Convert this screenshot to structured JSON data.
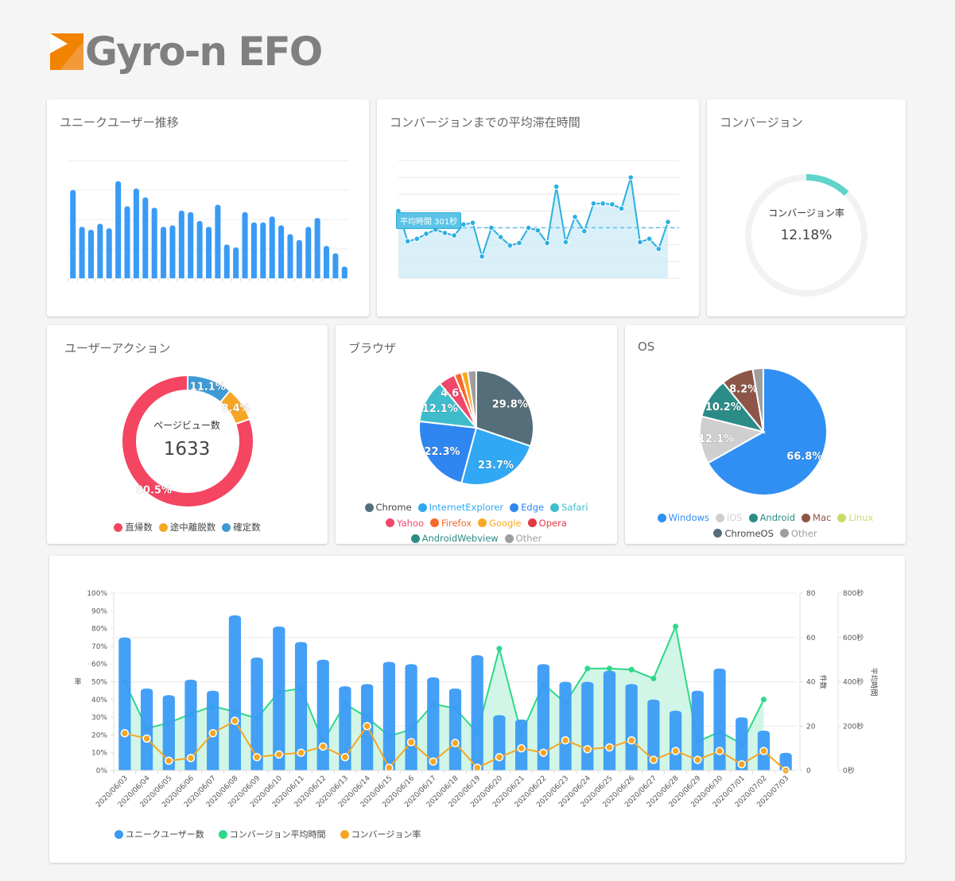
{
  "app": {
    "logo_text": "Gyro-n EFO",
    "brand_color": "#f08300"
  },
  "unique_users": {
    "title": "ユニークユーザー推移",
    "color": "#3a9bf5",
    "values": [
      60,
      35,
      33,
      37,
      34,
      66,
      49,
      61,
      55,
      48,
      35,
      36,
      46,
      45,
      39,
      35,
      50,
      23,
      21,
      45,
      38,
      38,
      42,
      36,
      30,
      26,
      35,
      41,
      22,
      17,
      8
    ]
  },
  "avg_time": {
    "title": "コンバージョンまでの平均滞在時間",
    "color": "#2bafe0",
    "avg_label": "平均時間 301秒",
    "avg_value": 301,
    "values": [
      400,
      220,
      235,
      265,
      290,
      270,
      255,
      320,
      330,
      130,
      300,
      245,
      195,
      210,
      300,
      285,
      210,
      545,
      215,
      365,
      280,
      445,
      445,
      440,
      415,
      600,
      215,
      235,
      175,
      335
    ],
    "ymax": 700
  },
  "conversion": {
    "title": "コンバージョン",
    "center_label": "コンバージョン率",
    "value_text": "12.18%",
    "rate": 0.1218,
    "color": "#5fd3cc",
    "track_color": "#f2f2f2"
  },
  "user_action": {
    "title": "ユーザーアクション",
    "center_label": "ページビュー数",
    "center_value": "1633",
    "slices": [
      {
        "name": "確定数",
        "value": 11.1,
        "label": "11.1%",
        "color": "#3e9bd6"
      },
      {
        "name": "途中離脱数",
        "value": 8.4,
        "label": "8.4%",
        "color": "#f5a623"
      },
      {
        "name": "直帰数",
        "value": 80.5,
        "label": "80.5%",
        "color": "#f44561"
      }
    ],
    "legend": [
      {
        "name": "直帰数",
        "color": "#f44561"
      },
      {
        "name": "途中離脱数",
        "color": "#f5a623"
      },
      {
        "name": "確定数",
        "color": "#3e9bd6"
      }
    ]
  },
  "browser": {
    "title": "ブラウザ",
    "slices": [
      {
        "name": "Chrome",
        "value": 29.8,
        "label": "29.8%",
        "color": "#546e7a"
      },
      {
        "name": "InternetExplorer",
        "value": 23.7,
        "label": "23.7%",
        "color": "#31a8f3"
      },
      {
        "name": "Edge",
        "value": 22.3,
        "label": "22.3%",
        "color": "#2f86f0"
      },
      {
        "name": "Safari",
        "value": 12.1,
        "label": "12.1%",
        "color": "#3fbccc"
      },
      {
        "name": "Yahoo",
        "value": 4.6,
        "label": "4.6%",
        "color": "#f0476a"
      },
      {
        "name": "Firefox",
        "value": 2.0,
        "label": "",
        "color": "#f56a2c"
      },
      {
        "name": "Google",
        "value": 1.8,
        "label": "",
        "color": "#f9a825"
      },
      {
        "name": "Opera",
        "value": 0.0,
        "label": "",
        "color": "#e53945"
      },
      {
        "name": "AndroidWebview",
        "value": 0.0,
        "label": "",
        "color": "#2a8c85"
      },
      {
        "name": "Other",
        "value": 2.4,
        "label": "",
        "color": "#9e9e9e"
      }
    ],
    "legend_rows": [
      [
        0,
        1,
        2,
        3
      ],
      [
        4,
        5,
        6,
        7
      ],
      [
        8,
        9
      ]
    ]
  },
  "os": {
    "title": "OS",
    "slices": [
      {
        "name": "Windows",
        "value": 66.8,
        "label": "66.8%",
        "color": "#2f8ff2"
      },
      {
        "name": "iOS",
        "value": 12.1,
        "label": "12.1%",
        "color": "#cfcfcf"
      },
      {
        "name": "Android",
        "value": 10.2,
        "label": "10.2%",
        "color": "#2b8c87"
      },
      {
        "name": "Mac",
        "value": 8.2,
        "label": "8.2%",
        "color": "#8d5548"
      },
      {
        "name": "Linux",
        "value": 0.0,
        "label": "",
        "color": "#c6dd6c"
      },
      {
        "name": "ChromeOS",
        "value": 0.0,
        "label": "",
        "color": "#546e7a"
      },
      {
        "name": "Other",
        "value": 2.7,
        "label": "",
        "color": "#9e9e9e"
      }
    ],
    "legend_rows": [
      [
        0,
        1,
        2,
        3,
        4
      ],
      [
        5,
        6
      ]
    ]
  },
  "chart_data": {
    "type": "bar",
    "title": "",
    "categories": [
      "2020/06/03",
      "2020/06/04",
      "2020/06/05",
      "2020/06/06",
      "2020/06/07",
      "2020/06/08",
      "2020/06/09",
      "2020/06/10",
      "2020/06/11",
      "2020/06/12",
      "2020/06/13",
      "2020/06/14",
      "2020/06/15",
      "2020/06/16",
      "2020/06/17",
      "2020/06/18",
      "2020/06/19",
      "2020/06/20",
      "2020/06/21",
      "2020/06/22",
      "2020/06/23",
      "2020/06/24",
      "2020/06/25",
      "2020/06/26",
      "2020/06/27",
      "2020/06/28",
      "2020/06/29",
      "2020/06/30",
      "2020/07/01",
      "2020/07/02",
      "2020/07/03"
    ],
    "series": [
      {
        "name": "ユニークユーザー数",
        "type": "bar",
        "axis": "count",
        "color": "#3a9bf5",
        "values": [
          60,
          37,
          34,
          41,
          36,
          70,
          51,
          65,
          58,
          50,
          38,
          39,
          49,
          48,
          42,
          37,
          52,
          25,
          23,
          48,
          40,
          40,
          45,
          39,
          32,
          27,
          36,
          46,
          24,
          18,
          8
        ]
      },
      {
        "name": "コンバージョン平均時間",
        "type": "area",
        "axis": "seconds",
        "color": "#2ed888",
        "values": [
          400,
          190,
          215,
          255,
          290,
          265,
          235,
          355,
          370,
          130,
          300,
          240,
          155,
          185,
          300,
          280,
          170,
          550,
          165,
          390,
          305,
          460,
          460,
          455,
          415,
          650,
          130,
          175,
          120,
          320,
          null
        ]
      },
      {
        "name": "コンバージョン率",
        "type": "line",
        "axis": "percent",
        "color": "#f5a623",
        "values": [
          21,
          18,
          5.5,
          7,
          21,
          28,
          7.5,
          9,
          10,
          13.5,
          7.5,
          25,
          1.5,
          16,
          5,
          15.5,
          1.5,
          7.5,
          12.5,
          10,
          17,
          12,
          13,
          17,
          6,
          11,
          6,
          11,
          3.5,
          11,
          0
        ]
      }
    ],
    "axes": {
      "left": {
        "label": "率",
        "min": 0,
        "max": 100,
        "ticks": [
          "0%",
          "10%",
          "20%",
          "30%",
          "40%",
          "50%",
          "60%",
          "70%",
          "80%",
          "90%",
          "100%"
        ]
      },
      "right": {
        "label": "件数",
        "min": 0,
        "max": 80,
        "ticks": [
          "0",
          "20",
          "40",
          "60",
          "80"
        ]
      },
      "right2": {
        "label": "平均時間",
        "min": 0,
        "max": 800,
        "ticks": [
          "0秒",
          "200秒",
          "400秒",
          "600秒",
          "800秒"
        ]
      }
    },
    "grid": true,
    "legend_position": "bottom-left"
  }
}
